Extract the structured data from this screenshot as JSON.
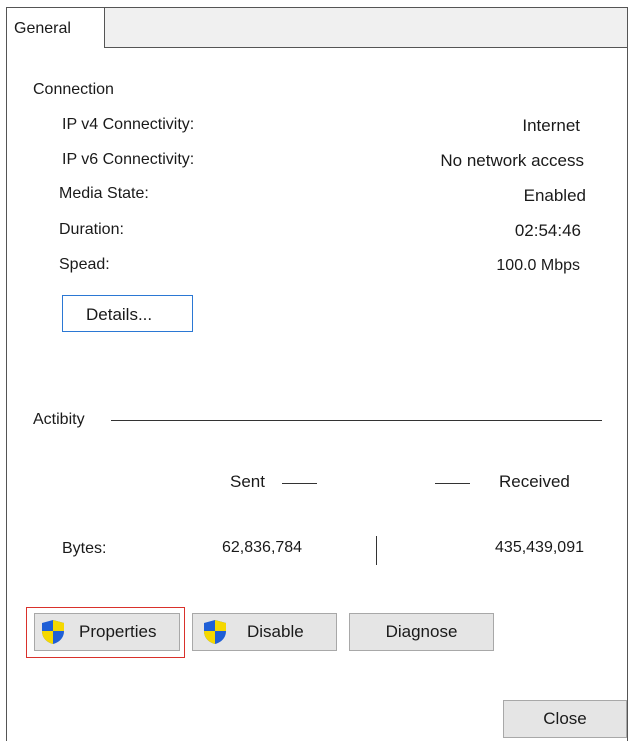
{
  "tabs": {
    "general": "General"
  },
  "connection": {
    "title": "Connection",
    "rows": [
      {
        "label": "IP v4 Connectivity:",
        "value": "Internet"
      },
      {
        "label": "IP v6 Connectivity:",
        "value": "No network access"
      },
      {
        "label": "Media State:",
        "value": "Enabled"
      },
      {
        "label": "Duration:",
        "value": "02:54:46"
      },
      {
        "label": "Spead:",
        "value": "100.0 Mbps"
      }
    ],
    "details_button": "Details..."
  },
  "activity": {
    "title": "Actibity",
    "sent_label": "Sent",
    "received_label": "Received",
    "bytes_label": "Bytes:",
    "bytes_sent": "62,836,784",
    "bytes_received": "435,439,091"
  },
  "buttons": {
    "properties": "Properties",
    "disable": "Disable",
    "diagnose": "Diagnose",
    "close": "Close"
  },
  "icons": {
    "properties_icon": "uac-shield-icon",
    "disable_icon": "uac-shield-icon"
  },
  "colors": {
    "selection_outline": "#d9312b",
    "details_border": "#2b78d4",
    "shield_blue": "#1f5fd6",
    "shield_yellow": "#f5d800"
  }
}
